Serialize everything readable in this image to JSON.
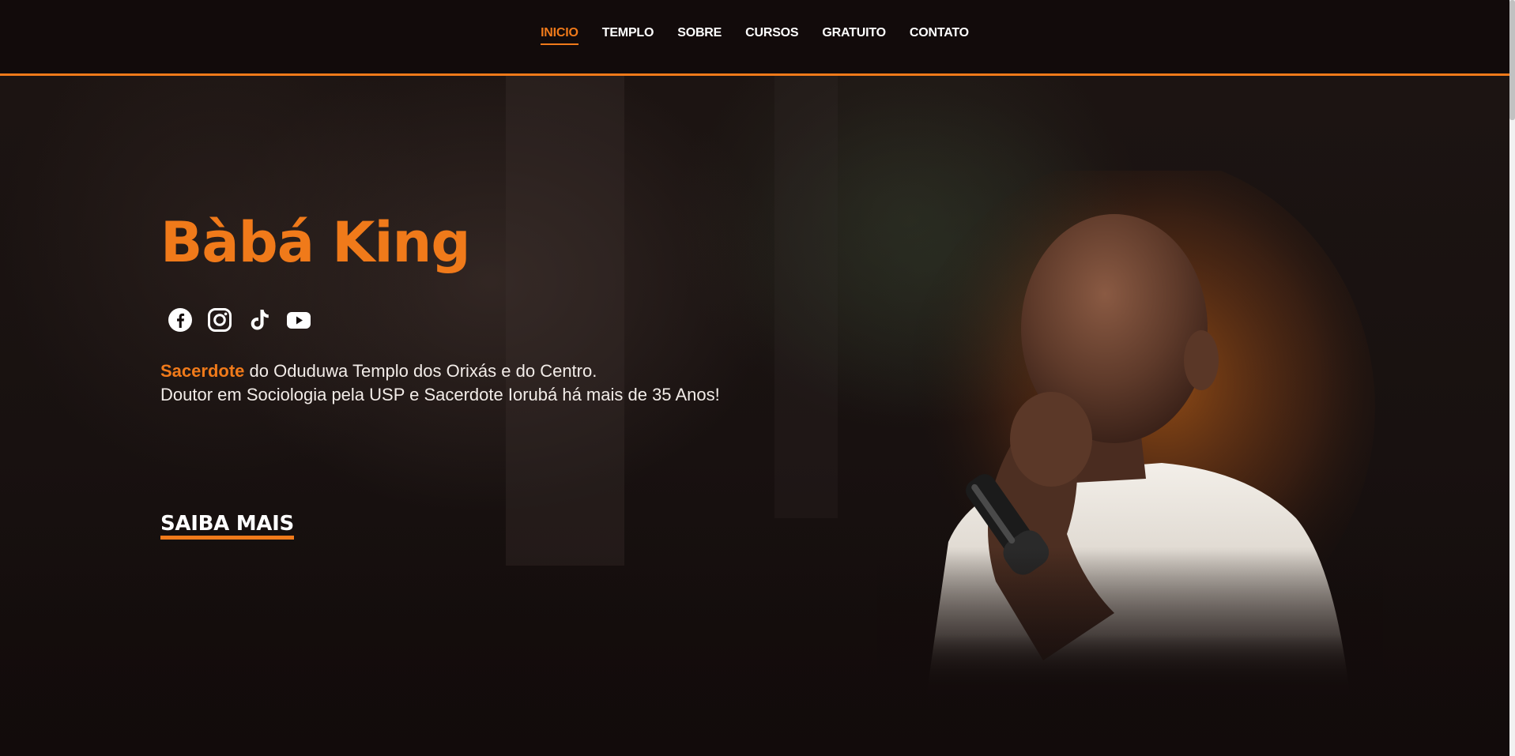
{
  "nav": {
    "items": [
      {
        "label": "INICIO",
        "active": true
      },
      {
        "label": "TEMPLO",
        "active": false
      },
      {
        "label": "SOBRE",
        "active": false
      },
      {
        "label": "CURSOS",
        "active": false
      },
      {
        "label": "GRATUITO",
        "active": false
      },
      {
        "label": "CONTATO",
        "active": false
      }
    ]
  },
  "hero": {
    "title": "Bàbá King",
    "highlight": "Sacerdote",
    "line1_rest": " do Oduduwa Templo dos Orixás e do Centro.",
    "line2": "Doutor em Sociologia pela USP e Sacerdote Iorubá há mais de 35 Anos!",
    "cta_label": "SAIBA MAIS"
  },
  "social": [
    "facebook-icon",
    "instagram-icon",
    "tiktok-icon",
    "youtube-icon"
  ],
  "colors": {
    "accent": "#f07a1a",
    "background": "#120b0b",
    "text": "#ffffff"
  }
}
